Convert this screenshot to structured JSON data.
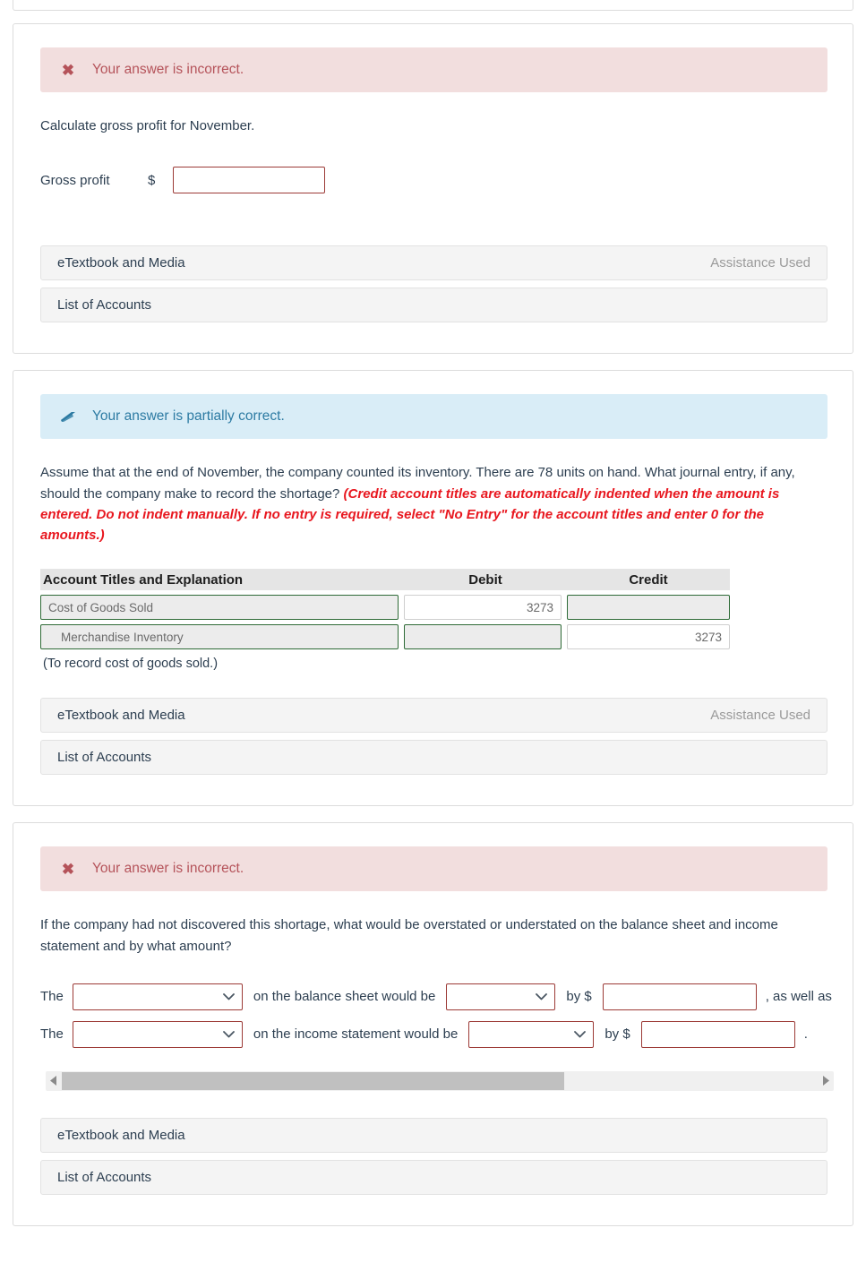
{
  "sections": [
    {
      "id": "gross-profit",
      "status": {
        "type": "incorrect",
        "icon": "x-mark-icon",
        "text": "Your answer is incorrect."
      },
      "prompt": "Calculate gross profit for November.",
      "field": {
        "label": "Gross profit",
        "currency": "$",
        "value": "",
        "placeholder": ""
      },
      "links": {
        "etextbook": "eTextbook and Media",
        "assistance": "Assistance Used",
        "accounts": "List of Accounts"
      }
    },
    {
      "id": "journal-entry",
      "status": {
        "type": "partial",
        "icon": "eraser-icon",
        "text": "Your answer is partially correct."
      },
      "prompt_plain": "Assume that at the end of November, the company counted its inventory. There are 78 units on hand. What journal entry, if any, should the company make to record the shortage? ",
      "prompt_emphasis": "(Credit account titles are automatically indented when the amount is entered. Do not indent manually. If no entry is required, select \"No Entry\" for the account titles and enter 0 for the amounts.)",
      "table": {
        "headers": [
          "Account Titles and Explanation",
          "Debit",
          "Credit"
        ],
        "rows": [
          {
            "account": "Cost of Goods Sold",
            "indent": false,
            "debit": "3273",
            "credit": ""
          },
          {
            "account": "Merchandise Inventory",
            "indent": true,
            "debit": "",
            "credit": "3273"
          }
        ],
        "note": "(To record cost of goods sold.)"
      },
      "links": {
        "etextbook": "eTextbook and Media",
        "assistance": "Assistance Used",
        "accounts": "List of Accounts"
      }
    },
    {
      "id": "overstated-understated",
      "status": {
        "type": "incorrect",
        "icon": "x-mark-icon",
        "text": "Your answer is incorrect."
      },
      "prompt": "If the company had not discovered this shortage, what would be overstated or understated on the balance sheet and income statement and by what amount?",
      "statements": [
        {
          "lead": "The",
          "account_select": "",
          "mid": "on the balance sheet would be",
          "direction_select": "",
          "by": "by $",
          "amount": "",
          "tail": ", as well as"
        },
        {
          "lead": "The",
          "account_select": "",
          "mid": "on the income statement would be",
          "direction_select": "",
          "by": "by $",
          "amount": "",
          "tail": "."
        }
      ],
      "scrollbar": {
        "left_arrow": "scroll-left-arrow-icon",
        "right_arrow": "scroll-right-arrow-icon",
        "thumb_ratio": "66.5%"
      },
      "links": {
        "etextbook": "eTextbook and Media",
        "accounts": "List of Accounts"
      }
    }
  ],
  "colors": {
    "incorrect_bg": "#f2dede",
    "incorrect_text": "#b5535a",
    "partial_bg": "#d9edf7",
    "partial_text": "#2d7ba3",
    "emphasis_red": "#e8171f",
    "input_border_red": "#9c3a36",
    "input_border_green": "#2e6b37",
    "row_bg": "#f4f4f4"
  }
}
